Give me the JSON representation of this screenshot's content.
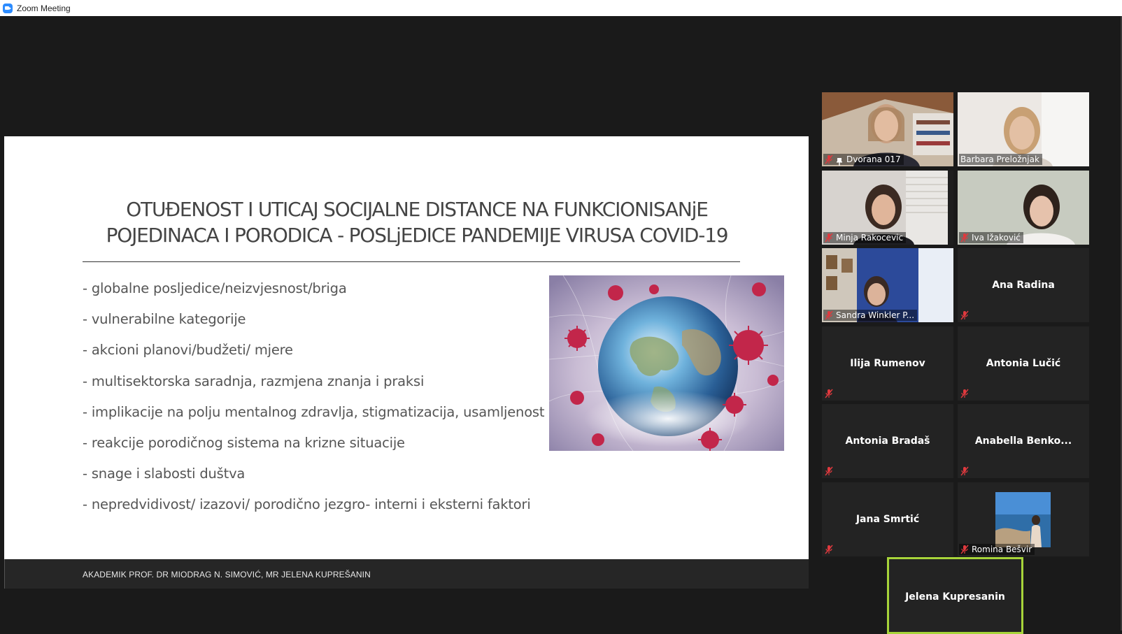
{
  "window": {
    "title": "Zoom Meeting"
  },
  "slide": {
    "title_line1": "OTUĐENOST I UTICAJ SOCIJALNE DISTANCE NA FUNKCIONISANjE",
    "title_line2": "POJEDINACA I PORODICA - POSLjEDICE PANDEMIJE VIRUSA COVID-19",
    "bullets": [
      "- globalne posljedice/neizvjesnost/briga",
      "- vulnerabilne kategorije",
      "- akcioni planovi/budžeti/ mjere",
      "- multisektorska saradnja, razmjena znanja i praksi",
      "- implikacije na polju mentalnog zdravlja, stigmatizacija, usamljenost",
      "- reakcije porodičnog sistema na krizne situacije",
      "- snage i slabosti duštva",
      "- nepredvidivost/ izazovi/ porodično jezgro- interni i eksterni faktori"
    ],
    "footer": "AKADEMIK PROF. DR MIODRAG N. SIMOVIĆ, MR JELENA KUPREŠANIN"
  },
  "participants": [
    {
      "name": "Dvorana 017",
      "video": true,
      "pinned": true,
      "muted": true
    },
    {
      "name": "Barbara Preložnjak",
      "video": true,
      "muted": false
    },
    {
      "name": "Minja Rakocevic",
      "video": true,
      "muted": true
    },
    {
      "name": "Iva Ižaković",
      "video": true,
      "muted": true
    },
    {
      "name": "Sandra Winkler P...",
      "video": true,
      "muted": true
    },
    {
      "name": "Ana Radina",
      "video": false,
      "muted": true
    },
    {
      "name": "Ilija Rumenov",
      "video": false,
      "muted": true
    },
    {
      "name": "Antonia Lučić",
      "video": false,
      "muted": true
    },
    {
      "name": "Antonia Bradaš",
      "video": false,
      "muted": true
    },
    {
      "name": "Anabella  Benko...",
      "video": false,
      "muted": true
    },
    {
      "name": "Jana Smrtić",
      "video": false,
      "muted": true
    },
    {
      "name": "Romina Bešvir",
      "video": false,
      "avatar": true,
      "muted": true
    },
    {
      "name": "Jelena Kupresanin",
      "video": false,
      "active_speaker": true
    }
  ],
  "colors": {
    "active_speaker_border": "#a7d43a",
    "muted_icon": "#e0393e",
    "zoom_blue": "#2d8cff"
  }
}
